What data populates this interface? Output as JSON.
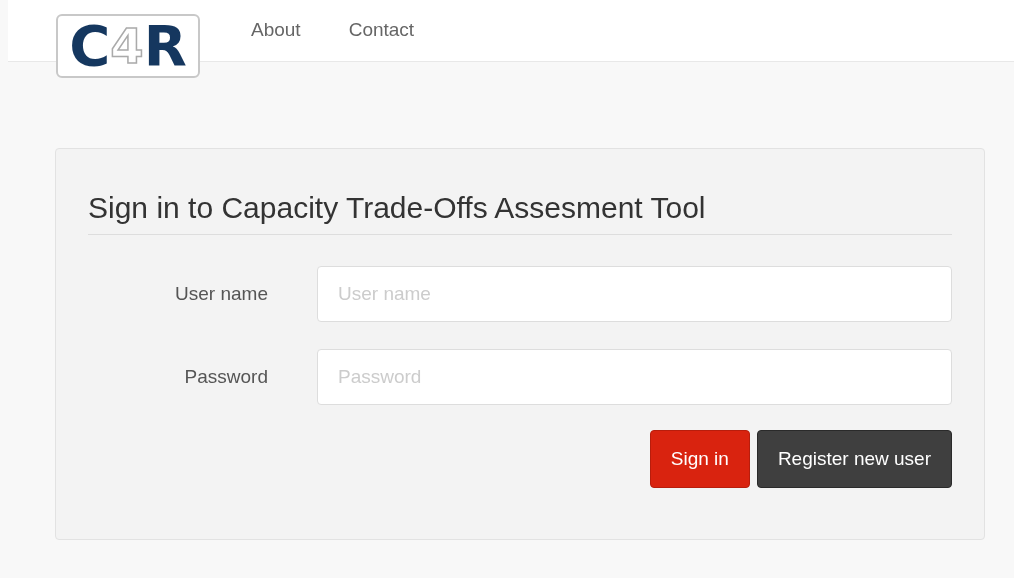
{
  "logo": {
    "parts": [
      {
        "text": "C",
        "kind": "solid"
      },
      {
        "text": "4",
        "kind": "outline"
      },
      {
        "text": "R",
        "kind": "solid"
      }
    ]
  },
  "nav": [
    {
      "label": "About"
    },
    {
      "label": "Contact"
    }
  ],
  "form": {
    "title": "Sign in to Capacity Trade-Offs Assesment Tool",
    "fields": [
      {
        "label": "User name",
        "placeholder": "User name"
      },
      {
        "label": "Password",
        "placeholder": "Password"
      }
    ],
    "buttons": [
      {
        "label": "Sign in",
        "kind": "primary"
      },
      {
        "label": "Register new user",
        "kind": "dark"
      }
    ]
  }
}
